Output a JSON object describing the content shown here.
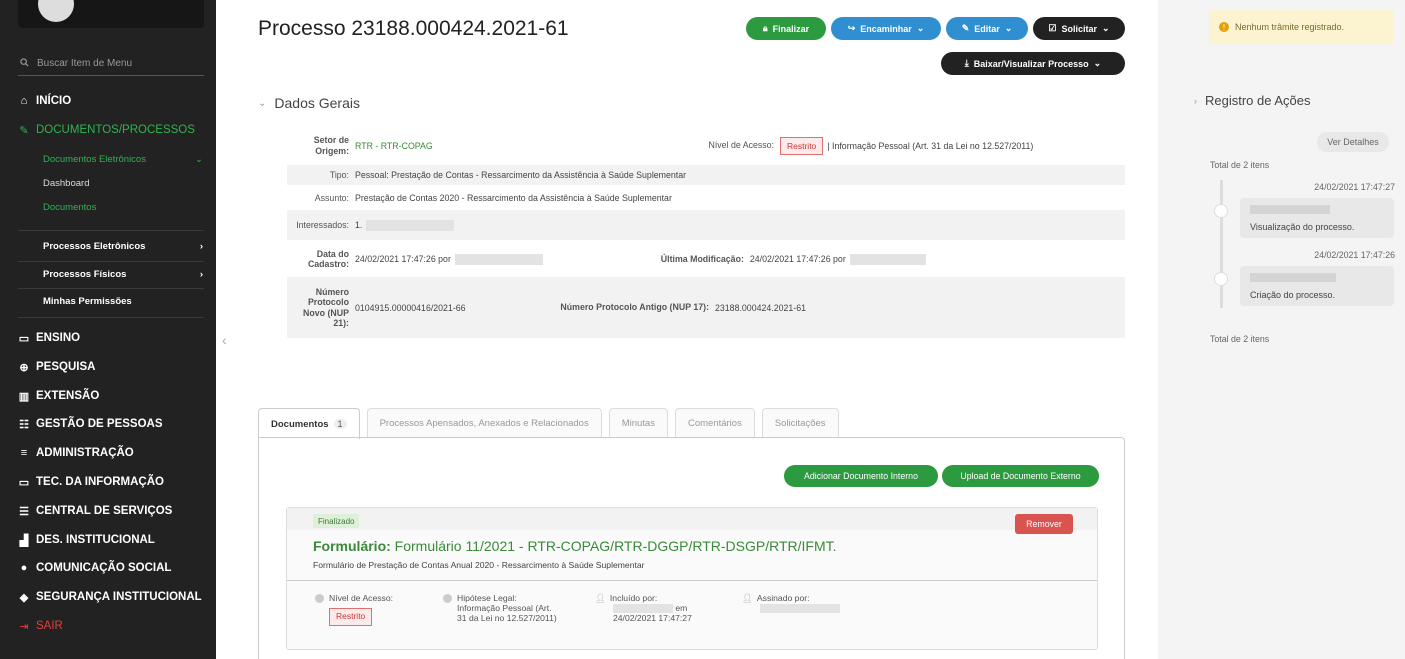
{
  "sidebar": {
    "search_placeholder": "Buscar Item de Menu",
    "items": [
      {
        "label": "INÍCIO"
      },
      {
        "label": "DOCUMENTOS/PROCESSOS"
      },
      {
        "label": "ENSINO"
      },
      {
        "label": "PESQUISA"
      },
      {
        "label": "EXTENSÃO"
      },
      {
        "label": "GESTÃO DE PESSOAS"
      },
      {
        "label": "ADMINISTRAÇÃO"
      },
      {
        "label": "TEC. DA INFORMAÇÃO"
      },
      {
        "label": "CENTRAL DE SERVIÇOS"
      },
      {
        "label": "DES. INSTITUCIONAL"
      },
      {
        "label": "COMUNICAÇÃO SOCIAL"
      },
      {
        "label": "SEGURANÇA INSTITUCIONAL"
      },
      {
        "label": "SAIR"
      }
    ],
    "sub": {
      "documentos_eletronicos": "Documentos Eletrônicos",
      "dashboard": "Dashboard",
      "documentos": "Documentos",
      "processos_eletronicos": "Processos Eletrônicos",
      "processos_fisicos": "Processos Físicos",
      "minhas_permissoes": "Minhas Permissões"
    }
  },
  "header": {
    "title": "Processo 23188.000424.2021-61",
    "buttons": {
      "finalizar": "Finalizar",
      "encaminhar": "Encaminhar",
      "editar": "Editar",
      "solicitar": "Solicitar",
      "baixar": "Baixar/Visualizar Processo"
    }
  },
  "dados_gerais": {
    "section_title": "Dados Gerais",
    "setor_label": "Setor de Origem:",
    "setor_value": "RTR - RTR-COPAG",
    "nivel_label": "Nível de Acesso:",
    "nivel_badge": "Restrito",
    "nivel_value": "| Informação Pessoal (Art. 31 da Lei no 12.527/2011)",
    "tipo_label": "Tipo:",
    "tipo_value": "Pessoal: Prestação de Contas - Ressarcimento da Assistência à Saúde Suplementar",
    "assunto_label": "Assunto:",
    "assunto_value": "Prestação de Contas 2020 - Ressarcimento da Assistência à Saúde Suplementar",
    "interessados_label": "Interessados:",
    "interessados_value": "1.",
    "data_label": "Data do Cadastro:",
    "data_value": "24/02/2021 17:47:26 por",
    "ultima_label": "Última Modificação:",
    "ultima_value": "24/02/2021 17:47:26 por",
    "num_novo_label": "Número Protocolo Novo (NUP 21):",
    "num_novo_value": "0104915.00000416/2021-66",
    "num_antigo_label": "Número Protocolo Antigo (NUP 17):",
    "num_antigo_value": "23188.000424.2021-61"
  },
  "tabs": [
    {
      "label": "Documentos",
      "badge": "1"
    },
    {
      "label": "Processos Apensados, Anexados e Relacionados"
    },
    {
      "label": "Minutas"
    },
    {
      "label": "Comentários"
    },
    {
      "label": "Solicitações"
    }
  ],
  "panel": {
    "add_interno": "Adicionar Documento Interno",
    "upload_externo": "Upload de Documento Externo"
  },
  "document": {
    "status": "Finalizado",
    "remove": "Remover",
    "title_bold": "Formulário:",
    "title_rest": "Formulário 11/2021 - RTR-COPAG/RTR-DGGP/RTR-DSGP/RTR/IFMT.",
    "subtitle": "Formulário de Prestação de Contas Anual 2020 - Ressarcimento à Saúde Suplementar",
    "nivel_label": "Nível de Acesso:",
    "nivel_value": "Restrito",
    "hipotese_label": "Hipótese Legal:",
    "hipotese_value": "Informação Pessoal (Art. 31 da Lei no 12.527/2011)",
    "incluido_label": "Incluído por:",
    "incluido_em": "em",
    "incluido_data": "24/02/2021 17:47:27",
    "assinado_label": "Assinado por:"
  },
  "right": {
    "warning": "Nenhum trâmite registrado.",
    "registro_title": "Registro de Ações",
    "ver_detalhes": "Ver Detalhes",
    "total_top": "Total de 2 itens",
    "entries": [
      {
        "time": "24/02/2021 17:47:27",
        "text": "Visualização do processo."
      },
      {
        "time": "24/02/2021 17:47:26",
        "text": "Criação do processo."
      }
    ],
    "total_bottom": "Total de 2 itens"
  }
}
